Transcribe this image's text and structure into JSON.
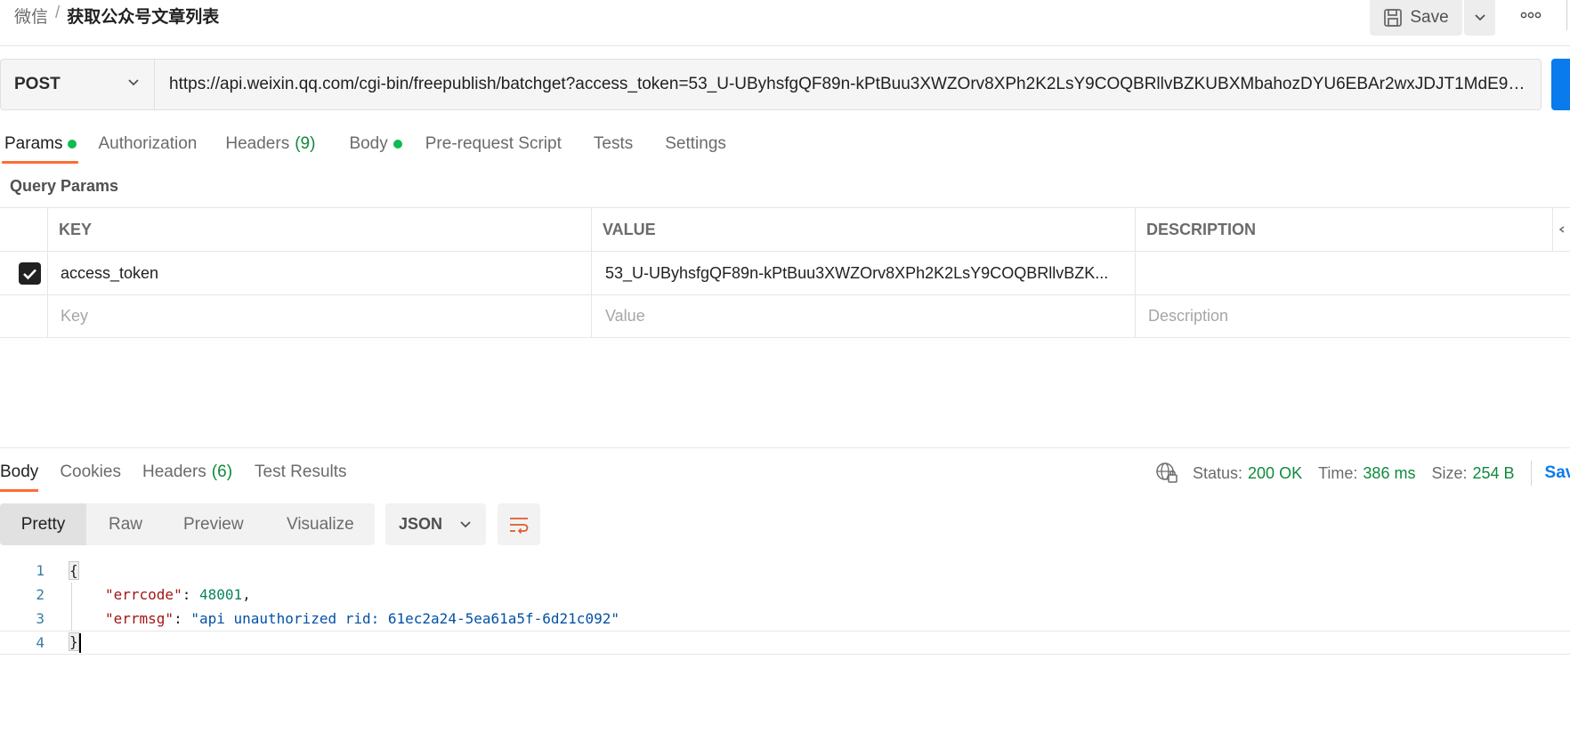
{
  "breadcrumb": {
    "parent": "微信",
    "separator": "/",
    "current": "获取公众号文章列表"
  },
  "header": {
    "save_label": "Save",
    "more_icon": "ellipsis-icon"
  },
  "request": {
    "method": "POST",
    "url": "https://api.weixin.qq.com/cgi-bin/freepublish/batchget?access_token=53_U-UByhsfgQF89n-kPtBuu3XWZOrv8XPh2K2LsY9COQBRllvBZKUBXMbahozDYU6EBAr2wxJDJT1MdE9_..."
  },
  "req_tabs": [
    {
      "label": "Params",
      "has_dot": true
    },
    {
      "label": "Authorization"
    },
    {
      "label": "Headers",
      "count": "(9)"
    },
    {
      "label": "Body",
      "has_dot": true
    },
    {
      "label": "Pre-request Script"
    },
    {
      "label": "Tests"
    },
    {
      "label": "Settings"
    }
  ],
  "query_params": {
    "title": "Query Params",
    "columns": [
      "KEY",
      "VALUE",
      "DESCRIPTION"
    ],
    "rows": [
      {
        "checked": true,
        "key": "access_token",
        "value": "53_U-UByhsfgQF89n-kPtBuu3XWZOrv8XPh2K2LsY9COQBRllvBZK...",
        "description": ""
      }
    ],
    "placeholders": {
      "key": "Key",
      "value": "Value",
      "description": "Description"
    }
  },
  "response": {
    "tabs": [
      {
        "label": "Body"
      },
      {
        "label": "Cookies"
      },
      {
        "label": "Headers",
        "count": "(6)"
      },
      {
        "label": "Test Results"
      }
    ],
    "status_label": "Status:",
    "status_value": "200 OK",
    "time_label": "Time:",
    "time_value": "386 ms",
    "size_label": "Size:",
    "size_value": "254 B",
    "save_label": "Save",
    "views": [
      "Pretty",
      "Raw",
      "Preview",
      "Visualize"
    ],
    "format": "JSON",
    "code": {
      "line_numbers": [
        "1",
        "2",
        "3",
        "4"
      ],
      "open_brace": "{",
      "close_brace": "}",
      "key1": "\"errcode\"",
      "val1": "48001",
      "key2": "\"errmsg\"",
      "val2": "\"api unauthorized rid: 61ec2a24-5ea61a5f-6d21c092\""
    }
  },
  "colors": {
    "accent": "#ff6c37",
    "send": "#097bed",
    "status_ok": "#0f8a3c",
    "dot": "#0cbb52"
  }
}
